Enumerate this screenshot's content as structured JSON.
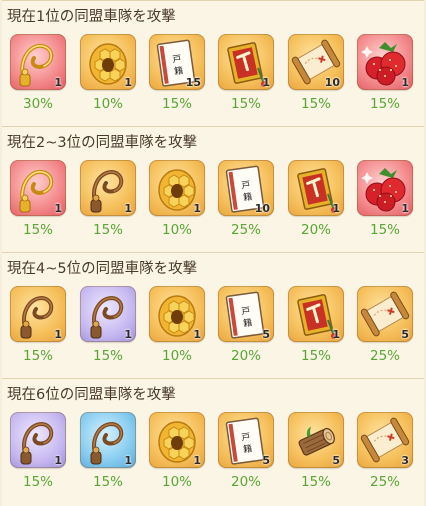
{
  "sections": [
    {
      "title": "現在1位の同盟車隊を攻撃",
      "items": [
        {
          "icon": "gold-whip-icon",
          "bg": "red",
          "count": "1",
          "pct": "30%"
        },
        {
          "icon": "honeycomb-icon",
          "bg": "gold",
          "count": "1",
          "pct": "10%"
        },
        {
          "icon": "family-register-book-icon",
          "bg": "gold",
          "count": "15",
          "pct": "15%"
        },
        {
          "icon": "red-token-icon",
          "bg": "gold",
          "count": "1",
          "pct": "15%"
        },
        {
          "icon": "treasure-map-scroll-icon",
          "bg": "gold",
          "count": "10",
          "pct": "15%"
        },
        {
          "icon": "strawberries-icon",
          "bg": "red",
          "count": "1",
          "pct": "15%"
        }
      ]
    },
    {
      "title": "現在2~3位の同盟車隊を攻撃",
      "items": [
        {
          "icon": "gold-whip-icon",
          "bg": "red",
          "count": "1",
          "pct": "15%"
        },
        {
          "icon": "brown-whip-icon",
          "bg": "gold",
          "count": "1",
          "pct": "15%"
        },
        {
          "icon": "honeycomb-icon",
          "bg": "gold",
          "count": "1",
          "pct": "10%"
        },
        {
          "icon": "family-register-book-icon",
          "bg": "gold",
          "count": "10",
          "pct": "25%"
        },
        {
          "icon": "red-token-icon",
          "bg": "gold",
          "count": "1",
          "pct": "20%"
        },
        {
          "icon": "strawberries-icon",
          "bg": "red",
          "count": "1",
          "pct": "15%"
        }
      ]
    },
    {
      "title": "現在4~5位の同盟車隊を攻撃",
      "items": [
        {
          "icon": "brown-whip-icon",
          "bg": "gold",
          "count": "1",
          "pct": "15%"
        },
        {
          "icon": "brown-whip-icon",
          "bg": "purple",
          "count": "1",
          "pct": "15%"
        },
        {
          "icon": "honeycomb-icon",
          "bg": "gold",
          "count": "1",
          "pct": "10%"
        },
        {
          "icon": "family-register-book-icon",
          "bg": "gold",
          "count": "5",
          "pct": "20%"
        },
        {
          "icon": "red-token-icon",
          "bg": "gold",
          "count": "1",
          "pct": "15%"
        },
        {
          "icon": "treasure-map-scroll-icon",
          "bg": "gold",
          "count": "5",
          "pct": "25%"
        }
      ]
    },
    {
      "title": "現在6位の同盟車隊を攻撃",
      "items": [
        {
          "icon": "brown-whip-icon",
          "bg": "purple",
          "count": "1",
          "pct": "15%"
        },
        {
          "icon": "brown-whip-icon",
          "bg": "blue",
          "count": "1",
          "pct": "15%"
        },
        {
          "icon": "honeycomb-icon",
          "bg": "gold",
          "count": "1",
          "pct": "10%"
        },
        {
          "icon": "family-register-book-icon",
          "bg": "gold",
          "count": "5",
          "pct": "20%"
        },
        {
          "icon": "wood-log-icon",
          "bg": "gold",
          "count": "5",
          "pct": "15%"
        },
        {
          "icon": "treasure-map-scroll-icon",
          "bg": "gold",
          "count": "3",
          "pct": "25%"
        }
      ]
    }
  ],
  "colors": {
    "percent_green": "#5aa634",
    "title_text": "#4a3a2c",
    "panel_bg": "#fbf5e6"
  }
}
